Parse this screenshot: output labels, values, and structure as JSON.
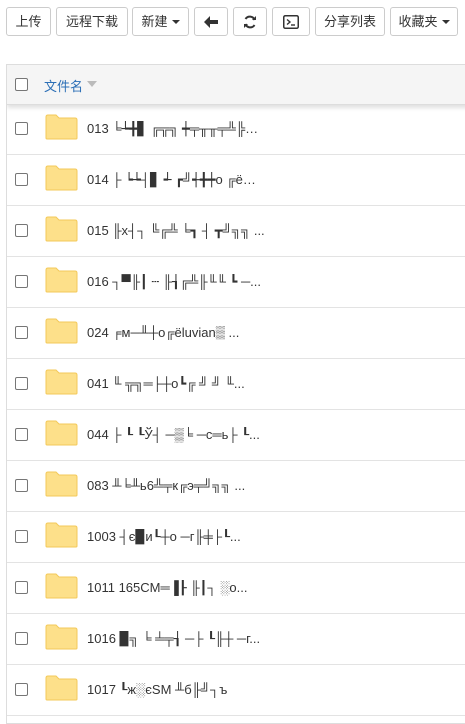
{
  "toolbar": {
    "upload_label": "上传",
    "remote_download_label": "远程下载",
    "new_label": "新建",
    "share_list_label": "分享列表",
    "favorites_label": "收藏夹"
  },
  "table": {
    "column_name": "文件名"
  },
  "files": [
    {
      "name": "013 ╘┶╋▋ ╔╦╗ ┿╤╥╥╤╩╠╦╔..."
    },
    {
      "name": "014 ├ ┕┶┤▋ ┵ ┏╝┽╋┿o ╔ë@t..."
    },
    {
      "name": "015 ╟x┤┐ ╚╔╩ ╘┓ ┤ ┳╝╗╗ ..."
    },
    {
      "name": "016 ┐▀╟┃ ┄ ╟┧╔╩╟╙╙ ┗ ─..."
    },
    {
      "name": "024 ╒м─╨┼o╔ëluvian▒ ..."
    },
    {
      "name": "041 ╙ ╦╗═├┼o┗╔ ╝ ╝ ╙..."
    },
    {
      "name": "044 ├ ┖ ┖Ў┤ ─▒╘ ─c═ь├ ┖..."
    },
    {
      "name": "083 ╨╘╨ь6╩╤к╔э╤╝╗╗ ..."
    },
    {
      "name": "1003 ┤є▉и┖┼o ─г╟╪├┖..."
    },
    {
      "name": "1011 165CM═▐┠ ╟┃┐ ░o..."
    },
    {
      "name": "1016 ▉╗ ╘ ╧╤┧ ─├ ┖╟┼ ─г..."
    },
    {
      "name": "1017 ┖ж░єSM ╨б╟╝┐ъ"
    }
  ],
  "colors": {
    "link_blue": "#2c6fb6",
    "folder_yellow": "#fde08a",
    "folder_edge": "#f3c95a"
  }
}
